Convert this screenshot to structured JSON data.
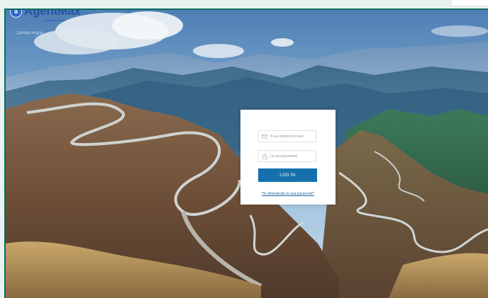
{
  "app": {
    "brand": "AgentMax",
    "brand_tagline": "by Affluent Networks",
    "logo_letter": "a",
    "language_label": "Cambia lingua",
    "colors": {
      "frame": "#0f6b63",
      "brand": "#2653a6",
      "button": "#1670ad"
    }
  },
  "login": {
    "email_placeholder": "Il suo indirizzo e-mail",
    "email_icon": "envelope-icon",
    "password_placeholder": "La sua password",
    "password_icon": "lock-icon",
    "button_label": "LOG IN",
    "forgot_link": "Ho dimenticato la sua password?"
  }
}
